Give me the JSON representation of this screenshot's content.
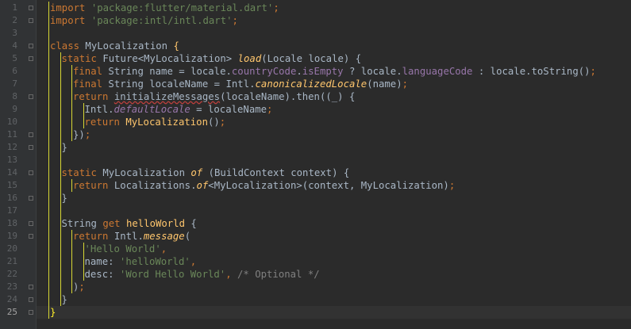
{
  "editor": {
    "current_line": 25,
    "lines": [
      {
        "num": "1",
        "indent": 0,
        "tokens": [
          {
            "t": "import ",
            "c": "kw"
          },
          {
            "t": "'package:flutter/material.dart'",
            "c": "str"
          },
          {
            "t": ";",
            "c": "kw"
          }
        ]
      },
      {
        "num": "2",
        "indent": 0,
        "tokens": [
          {
            "t": "import ",
            "c": "kw"
          },
          {
            "t": "'package:intl/intl.dart'",
            "c": "str"
          },
          {
            "t": ";",
            "c": "kw"
          }
        ]
      },
      {
        "num": "3",
        "indent": 0,
        "tokens": []
      },
      {
        "num": "4",
        "indent": 0,
        "tokens": [
          {
            "t": "class ",
            "c": "kw"
          },
          {
            "t": "MyLocalization "
          },
          {
            "t": "{",
            "c": "brace"
          }
        ]
      },
      {
        "num": "5",
        "indent": 1,
        "tokens": [
          {
            "t": "static ",
            "c": "kw"
          },
          {
            "t": "Future<MyLocalization> "
          },
          {
            "t": "load",
            "c": "fn"
          },
          {
            "t": "(Locale locale) {"
          }
        ]
      },
      {
        "num": "6",
        "indent": 2,
        "tokens": [
          {
            "t": "final ",
            "c": "kw"
          },
          {
            "t": "String name = locale."
          },
          {
            "t": "countryCode",
            "c": "prop"
          },
          {
            "t": "."
          },
          {
            "t": "isEmpty",
            "c": "prop"
          },
          {
            "t": " ? locale."
          },
          {
            "t": "languageCode",
            "c": "prop"
          },
          {
            "t": " : locale.toString()"
          },
          {
            "t": ";",
            "c": "kw"
          }
        ]
      },
      {
        "num": "7",
        "indent": 2,
        "tokens": [
          {
            "t": "final ",
            "c": "kw"
          },
          {
            "t": "String localeName = Intl."
          },
          {
            "t": "canonicalizedLocale",
            "c": "fn"
          },
          {
            "t": "(name)"
          },
          {
            "t": ";",
            "c": "kw"
          }
        ]
      },
      {
        "num": "8",
        "indent": 2,
        "tokens": [
          {
            "t": "return ",
            "c": "kw"
          },
          {
            "t": "initializeMessages",
            "c": "und"
          },
          {
            "t": "(localeName).then((_) {"
          }
        ]
      },
      {
        "num": "9",
        "indent": 3,
        "tokens": [
          {
            "t": "Intl."
          },
          {
            "t": "defaultLocale",
            "c": "pit"
          },
          {
            "t": " = localeName"
          },
          {
            "t": ";",
            "c": "kw"
          }
        ]
      },
      {
        "num": "10",
        "indent": 3,
        "tokens": [
          {
            "t": "return ",
            "c": "kw"
          },
          {
            "t": "MyLocalization",
            "c": "cls"
          },
          {
            "t": "()"
          },
          {
            "t": ";",
            "c": "kw"
          }
        ]
      },
      {
        "num": "11",
        "indent": 2,
        "tokens": [
          {
            "t": "})"
          },
          {
            "t": ";",
            "c": "kw"
          }
        ]
      },
      {
        "num": "12",
        "indent": 1,
        "tokens": [
          {
            "t": "}"
          }
        ]
      },
      {
        "num": "13",
        "indent": 1,
        "tokens": []
      },
      {
        "num": "14",
        "indent": 1,
        "tokens": [
          {
            "t": "static ",
            "c": "kw"
          },
          {
            "t": "MyLocalization "
          },
          {
            "t": "of",
            "c": "fn"
          },
          {
            "t": " (BuildContext context) {"
          }
        ]
      },
      {
        "num": "15",
        "indent": 2,
        "tokens": [
          {
            "t": "return ",
            "c": "kw"
          },
          {
            "t": "Localizations."
          },
          {
            "t": "of",
            "c": "fn"
          },
          {
            "t": "<MyLocalization>(context, MyLocalization)"
          },
          {
            "t": ";",
            "c": "kw"
          }
        ]
      },
      {
        "num": "16",
        "indent": 1,
        "tokens": [
          {
            "t": "}"
          }
        ]
      },
      {
        "num": "17",
        "indent": 1,
        "tokens": []
      },
      {
        "num": "18",
        "indent": 1,
        "tokens": [
          {
            "t": "String "
          },
          {
            "t": "get ",
            "c": "kw"
          },
          {
            "t": "helloWorld",
            "c": "cls"
          },
          {
            "t": " {"
          }
        ]
      },
      {
        "num": "19",
        "indent": 2,
        "tokens": [
          {
            "t": "return ",
            "c": "kw"
          },
          {
            "t": "Intl."
          },
          {
            "t": "message",
            "c": "fn"
          },
          {
            "t": "("
          }
        ]
      },
      {
        "num": "20",
        "indent": 3,
        "tokens": [
          {
            "t": "'Hello World'",
            "c": "str"
          },
          {
            "t": ",",
            "c": "kw"
          }
        ]
      },
      {
        "num": "21",
        "indent": 3,
        "tokens": [
          {
            "t": "name: "
          },
          {
            "t": "'helloWorld'",
            "c": "str"
          },
          {
            "t": ",",
            "c": "kw"
          }
        ]
      },
      {
        "num": "22",
        "indent": 3,
        "tokens": [
          {
            "t": "desc: "
          },
          {
            "t": "'Word Hello World'",
            "c": "str"
          },
          {
            "t": ", ",
            "c": "kw"
          },
          {
            "t": "/* Optional */",
            "c": "cmt"
          }
        ]
      },
      {
        "num": "23",
        "indent": 2,
        "tokens": [
          {
            "t": ")"
          },
          {
            "t": ";",
            "c": "kw"
          }
        ]
      },
      {
        "num": "24",
        "indent": 1,
        "tokens": [
          {
            "t": "}"
          }
        ]
      },
      {
        "num": "25",
        "indent": 0,
        "tokens": [
          {
            "t": "}",
            "c": "caret"
          }
        ]
      }
    ]
  },
  "colors": {
    "background": "#2b2b2b",
    "gutter": "#313335",
    "current_line": "#323232",
    "keyword": "#cc7832",
    "string": "#6a8759",
    "function": "#ffc66d",
    "property": "#9876aa",
    "comment": "#808080",
    "text": "#a9b7c6",
    "indent_guide": "#d7d734"
  }
}
